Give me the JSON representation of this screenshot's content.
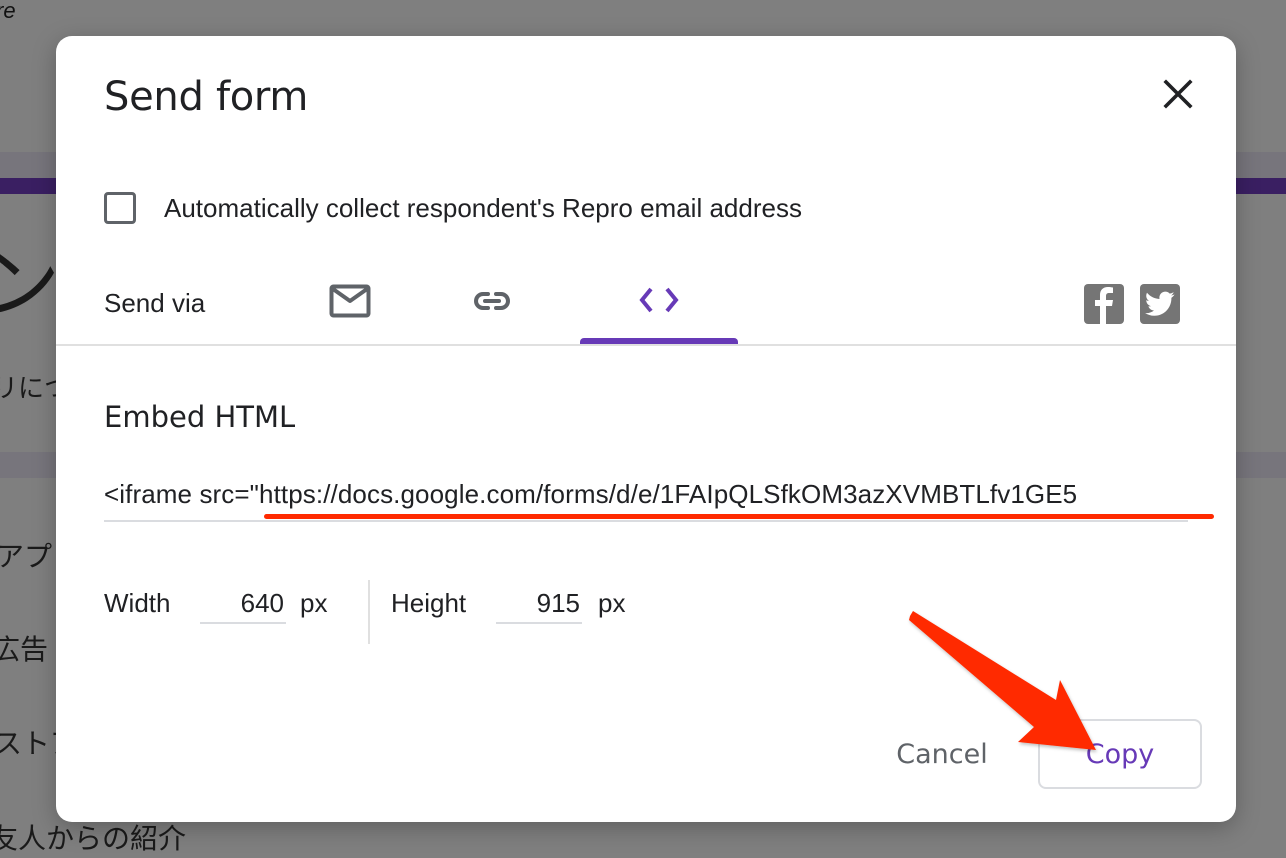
{
  "background": {
    "top_word": "re",
    "large_glyph": "ン",
    "lines": [
      "リにつ",
      "アプ",
      "広告",
      "ストア",
      "友人からの紹介"
    ]
  },
  "dialog": {
    "title": "Send form",
    "close_icon": "close-icon",
    "collect_email": {
      "label": "Automatically collect respondent's Repro email address",
      "checked": false
    },
    "send_via": {
      "label": "Send via",
      "tabs": [
        {
          "id": "email",
          "icon": "mail-icon",
          "active": false
        },
        {
          "id": "link",
          "icon": "link-icon",
          "active": false
        },
        {
          "id": "embed",
          "icon": "code-brackets-icon",
          "active": true
        }
      ],
      "social": [
        {
          "id": "facebook",
          "icon": "facebook-icon"
        },
        {
          "id": "twitter",
          "icon": "twitter-icon"
        }
      ]
    },
    "embed": {
      "heading": "Embed HTML",
      "code": "<iframe src=\"https://docs.google.com/forms/d/e/1FAIpQLSfkOM3azXVMBTLfv1GE5"
    },
    "dimensions": {
      "width_label": "Width",
      "width_value": "640",
      "width_unit": "px",
      "height_label": "Height",
      "height_value": "915",
      "height_unit": "px"
    },
    "actions": {
      "cancel_label": "Cancel",
      "copy_label": "Copy"
    }
  },
  "colors": {
    "accent": "#673ab7",
    "annotation": "#ff2a00",
    "icon_gray": "#5f6368",
    "social_gray": "#757575"
  }
}
